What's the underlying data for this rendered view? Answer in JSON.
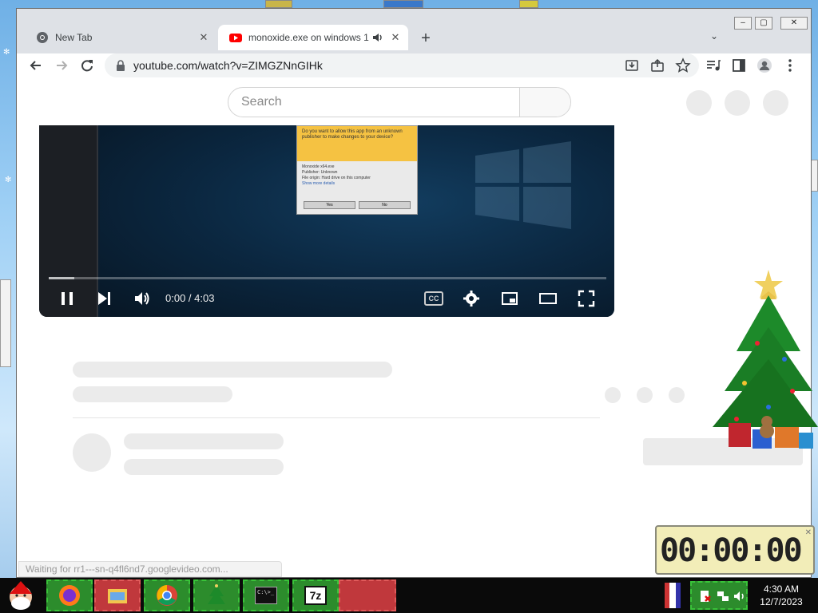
{
  "browser": {
    "tabs": [
      {
        "title": "New Tab",
        "icon": "chrome-icon",
        "active": false
      },
      {
        "title": "monoxide.exe on windows 1",
        "icon": "youtube-icon",
        "active": true
      }
    ],
    "new_tab_label": "+",
    "address": {
      "url": "youtube.com/watch?v=ZIMGZNnGIHk"
    },
    "status_text": "Waiting for rr1---sn-q4fl6nd7.googlevideo.com..."
  },
  "youtube": {
    "search_placeholder": "Search",
    "player": {
      "time": "0:00 / 4:03",
      "progress": 0.0,
      "cc_label": "CC",
      "uac": {
        "header": "Do you want to allow this app from an unknown publisher to make changes to your device?",
        "app_name": "Monoxide x64.exe",
        "publisher_label": "Publisher: Unknown",
        "origin_label": "File origin: Hard drive on this computer",
        "more_link": "Show more details",
        "yes_label": "Yes",
        "no_label": "No"
      }
    }
  },
  "clock_widget": {
    "display": "00:00:00"
  },
  "taskbar": {
    "apps": [
      "firefox-icon",
      "explorer-icon",
      "chrome-icon",
      "tree-icon",
      "cmd-icon",
      "7zip-icon"
    ],
    "time": "4:30 AM",
    "date": "12/7/2023",
    "zip_label": "7z",
    "cmd_label": "C:\\>_"
  }
}
